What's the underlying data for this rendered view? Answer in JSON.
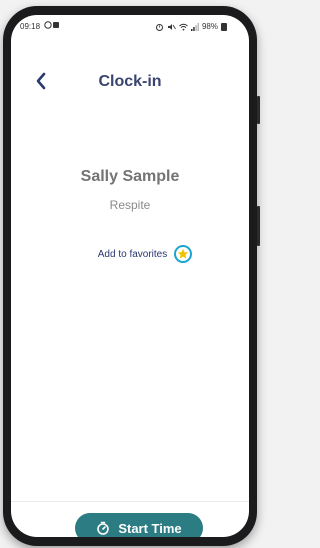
{
  "status_bar": {
    "time": "09:18",
    "battery": "98%"
  },
  "header": {
    "title": "Clock-in"
  },
  "client": {
    "name": "Sally Sample",
    "program": "Respite"
  },
  "favorites": {
    "label": "Add to favorites"
  },
  "footer": {
    "start_label": "Start Time"
  },
  "colors": {
    "title": "#3a4470",
    "accent": "#1aa6d1",
    "button": "#2b7c83",
    "star": "#f2c200"
  }
}
